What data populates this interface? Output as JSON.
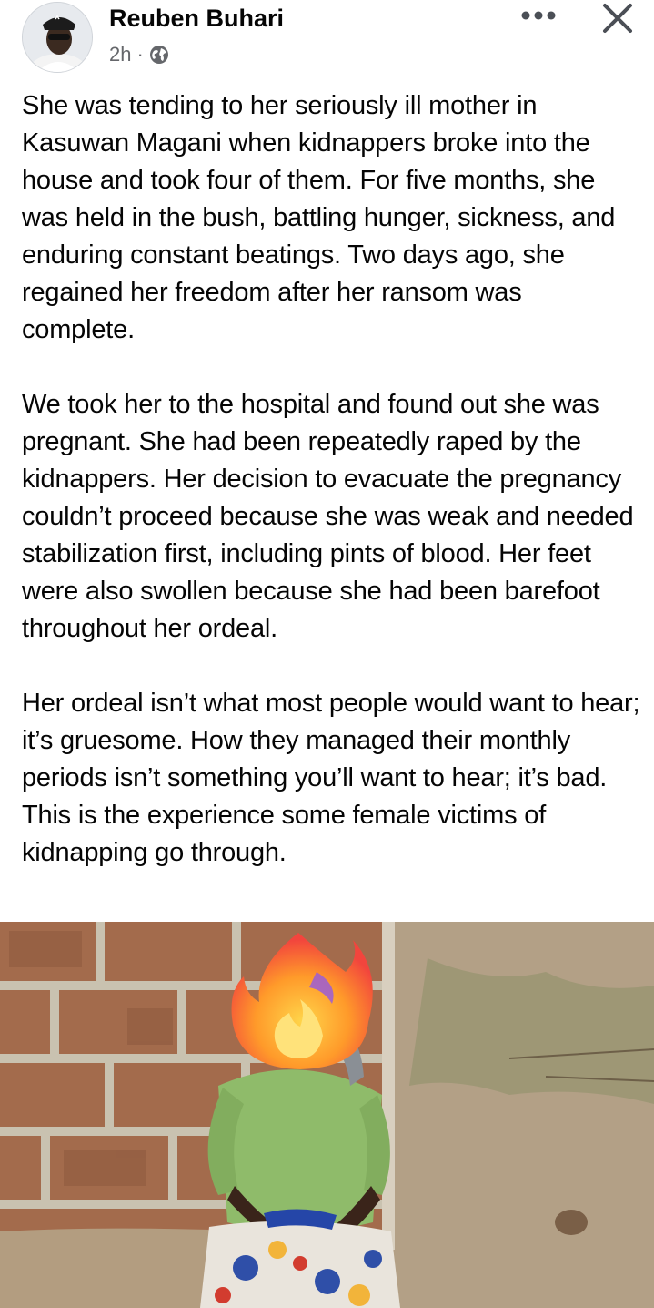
{
  "post": {
    "author": {
      "name": "Reuben Buhari",
      "avatar_icon": "profile-photo"
    },
    "meta": {
      "time": "2h",
      "separator": "·",
      "audience_icon": "globe-icon"
    },
    "actions": {
      "more_icon": "more-horizontal-icon",
      "close_icon": "close-icon"
    },
    "paragraphs": [
      "She was tending to her seriously ill mother in Kasuwan Magani when kidnappers broke into the house and took four of them. For five months, she was held in the bush, battling hunger, sickness, and enduring constant beatings. Two days ago, she regained her freedom after her ransom was complete.",
      "We took her to the hospital and found out she was pregnant. She had been repeatedly raped by the kidnappers. Her decision to evacuate the pregnancy couldn’t proceed because she was weak and needed stabilization first, including pints of blood. Her feet were also swollen because she had been barefoot throughout her ordeal.",
      "Her ordeal isn’t what most people would want to hear; it’s gruesome. How they managed their monthly periods isn’t something you’ll want to hear; it’s bad. This is the experience some female victims of kidnapping go through."
    ],
    "photo": {
      "face_cover_emoji": "fire-emoji"
    }
  },
  "colors": {
    "text": "#050505",
    "secondary_text": "#65676b",
    "icon": "#4b4f56"
  }
}
